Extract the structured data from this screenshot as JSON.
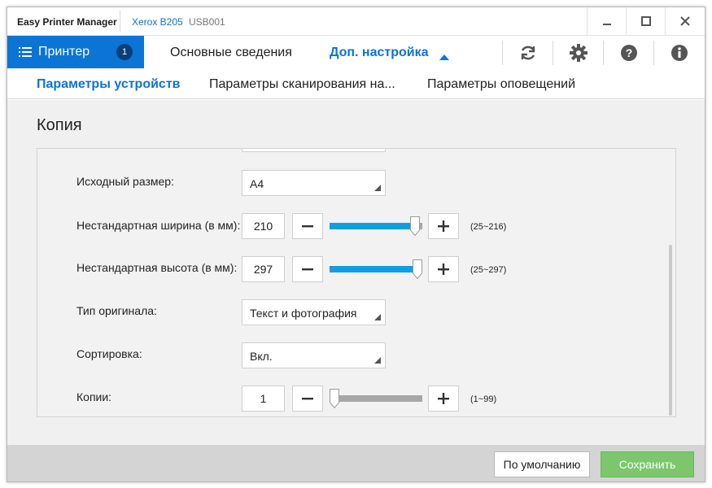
{
  "window": {
    "app_title": "Easy Printer Manager",
    "device_name": "Xerox B205",
    "device_port": "USB001",
    "controls": [
      "minimize-icon",
      "maximize-icon",
      "close-icon"
    ]
  },
  "header": {
    "printer_tab": {
      "label": "Принтер",
      "badge": "1",
      "icon": "list-icon"
    },
    "tabs": [
      {
        "label": "Основные сведения"
      },
      {
        "label": "Доп. настройка"
      }
    ],
    "icons": [
      "refresh-icon",
      "gear-icon",
      "help-icon",
      "info-icon"
    ]
  },
  "subtabs": [
    {
      "label": "Параметры устройств"
    },
    {
      "label": "Параметры сканирования на..."
    },
    {
      "label": "Параметры оповещений"
    }
  ],
  "section": {
    "title": "Копия",
    "original_size": {
      "label": "Исходный размер:",
      "value": "A4"
    },
    "custom_width": {
      "label": "Нестандартная ширина (в мм):",
      "value": "210",
      "range": "(25~216)",
      "level": 0.97
    },
    "custom_height": {
      "label": "Нестандартная высота (в мм):",
      "value": "297",
      "range": "(25~297)",
      "level": 1.0
    },
    "original_type": {
      "label": "Тип оригинала:",
      "value": "Текст и фотография"
    },
    "collation": {
      "label": "Сортировка:",
      "value": "Вкл."
    },
    "copies": {
      "label": "Копии:",
      "value": "1",
      "range": "(1~99)",
      "level": 0.0
    }
  },
  "footer": {
    "default_label": "По умолчанию",
    "save_label": "Сохранить"
  },
  "colors": {
    "accent": "#0b74d4",
    "slider_fill": "#0f9ee0",
    "save_button": "#7cc76e"
  }
}
